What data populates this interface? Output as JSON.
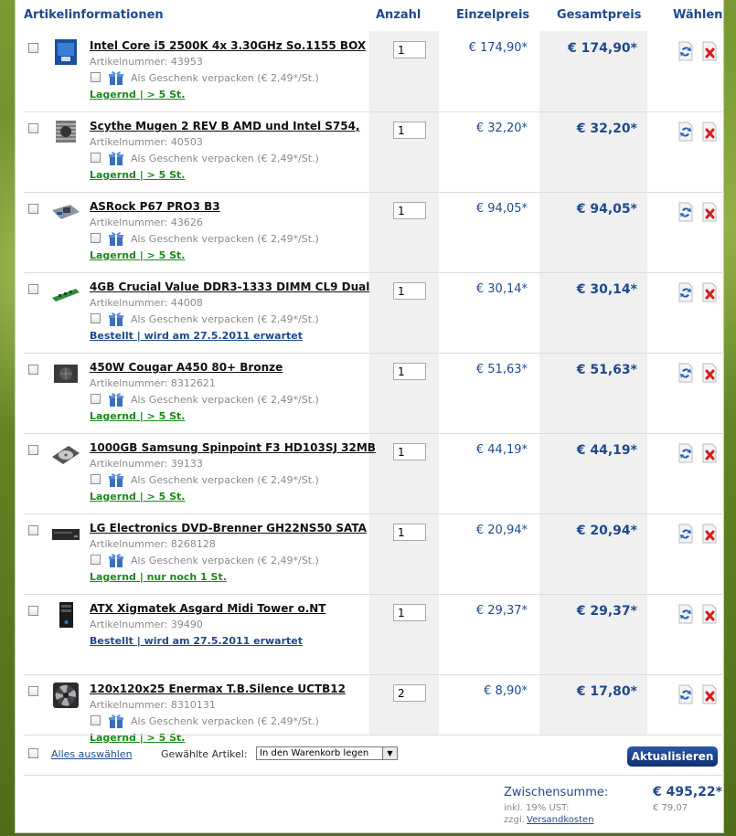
{
  "header": {
    "col_info": "Artikelinformationen",
    "col_qty": "Anzahl",
    "col_unit": "Einzelpreis",
    "col_total": "Gesamtpreis",
    "col_choose": "Wählen"
  },
  "gift_label": "Als Geschenk verpacken (€ 2,49*/St.)",
  "items": [
    {
      "title": "Intel Core i5 2500K 4x 3.30GHz So.1155 BOX",
      "artnr": "Artikelnummer: 43953",
      "gift": true,
      "avail": "Lagernd | > 5 St.",
      "avail_status": "green",
      "qty": "1",
      "unit": "€ 174,90*",
      "total": "€ 174,90*",
      "thumb_icon": "cpu-box-icon"
    },
    {
      "title": "Scythe Mugen 2 REV B AMD und Intel S754,",
      "artnr": "Artikelnummer: 40503",
      "gift": true,
      "avail": "Lagernd | > 5 St.",
      "avail_status": "green",
      "qty": "1",
      "unit": "€ 32,20*",
      "total": "€ 32,20*",
      "thumb_icon": "cpu-cooler-icon"
    },
    {
      "title": "ASRock P67 PRO3 B3",
      "artnr": "Artikelnummer: 43626",
      "gift": true,
      "avail": "Lagernd | > 5 St.",
      "avail_status": "green",
      "qty": "1",
      "unit": "€ 94,05*",
      "total": "€ 94,05*",
      "thumb_icon": "motherboard-icon"
    },
    {
      "title": "4GB Crucial Value DDR3-1333 DIMM CL9 Dual",
      "artnr": "Artikelnummer: 44008",
      "gift": true,
      "avail": "Bestellt | wird am 27.5.2011 erwartet",
      "avail_status": "blue",
      "qty": "1",
      "unit": "€ 30,14*",
      "total": "€ 30,14*",
      "thumb_icon": "ram-module-icon"
    },
    {
      "title": "450W Cougar A450 80+ Bronze",
      "artnr": "Artikelnummer: 8312621",
      "gift": true,
      "avail": "Lagernd | > 5 St.",
      "avail_status": "green",
      "qty": "1",
      "unit": "€ 51,63*",
      "total": "€ 51,63*",
      "thumb_icon": "power-supply-icon"
    },
    {
      "title": "1000GB Samsung Spinpoint F3 HD103SJ 32MB",
      "artnr": "Artikelnummer: 39133",
      "gift": true,
      "avail": "Lagernd | > 5 St.",
      "avail_status": "green",
      "qty": "1",
      "unit": "€ 44,19*",
      "total": "€ 44,19*",
      "thumb_icon": "hard-drive-icon"
    },
    {
      "title": "LG Electronics DVD-Brenner GH22NS50 SATA",
      "artnr": "Artikelnummer: 8268128",
      "gift": true,
      "avail": "Lagernd | nur noch 1 St.",
      "avail_status": "green",
      "qty": "1",
      "unit": "€ 20,94*",
      "total": "€ 20,94*",
      "thumb_icon": "dvd-drive-icon"
    },
    {
      "title": "ATX Xigmatek Asgard Midi Tower o.NT",
      "artnr": "Artikelnummer: 39490",
      "gift": false,
      "avail": "Bestellt | wird am 27.5.2011 erwartet",
      "avail_status": "blue",
      "qty": "1",
      "unit": "€ 29,37*",
      "total": "€ 29,37*",
      "thumb_icon": "pc-tower-icon"
    },
    {
      "title": "120x120x25 Enermax T.B.Silence UCTB12",
      "artnr": "Artikelnummer: 8310131",
      "gift": true,
      "avail": "Lagernd | > 5 St.",
      "avail_status": "green",
      "qty": "2",
      "unit": "€ 8,90*",
      "total": "€ 17,80*",
      "thumb_icon": "case-fan-icon"
    }
  ],
  "footer": {
    "select_all": "Alles auswählen",
    "selected_label": "Gewählte Artikel:",
    "action_value": "In den Warenkorb legen",
    "update_button": "Aktualisieren"
  },
  "summary": {
    "subtotal_label": "Zwischensumme:",
    "subtotal_value": "€ 495,22*",
    "vat_label": "inkl. 19% UST:",
    "vat_value": "€ 79,07",
    "shipping_prefix": "zzgl.",
    "shipping_link": "Versandkosten"
  },
  "colors": {
    "accent_blue": "#1f4a8c",
    "available_green": "#1b8a1b",
    "remove_red": "#d42020"
  }
}
